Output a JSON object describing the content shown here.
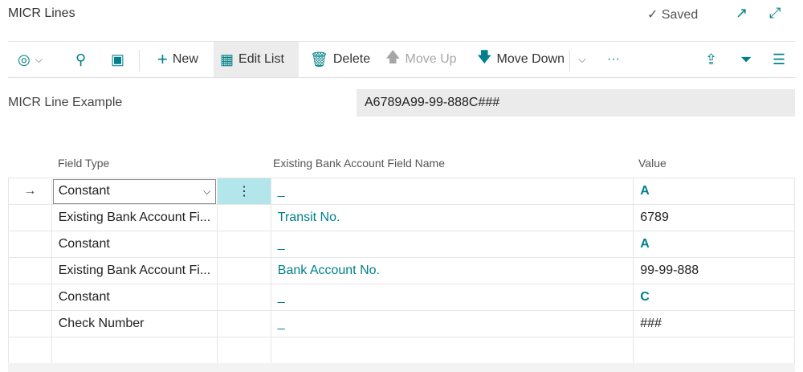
{
  "header": {
    "title": "MICR Lines",
    "saved": "Saved"
  },
  "toolbar": {
    "new": "New",
    "edit_list": "Edit List",
    "delete": "Delete",
    "move_up": "Move Up",
    "move_down": "Move Down",
    "more": "···"
  },
  "example": {
    "label": "MICR Line Example",
    "value": "A6789A99-99-888C###"
  },
  "table": {
    "columns": [
      "Field Type",
      "Existing Bank Account Field Name",
      "Value"
    ],
    "rows": [
      {
        "field_type": "Constant",
        "existing": "_",
        "value": "A"
      },
      {
        "field_type": "Existing Bank Account Fi...",
        "existing": "Transit No.",
        "value": "6789"
      },
      {
        "field_type": "Constant",
        "existing": "_",
        "value": "A"
      },
      {
        "field_type": "Existing Bank Account Fi...",
        "existing": "Bank Account No.",
        "value": "99-99-888"
      },
      {
        "field_type": "Constant",
        "existing": "_",
        "value": "C"
      },
      {
        "field_type": "Check Number",
        "existing": "_",
        "value": "###"
      }
    ]
  },
  "colors": {
    "accent": "#00808a",
    "selected_cell": "#b3e6ea"
  }
}
